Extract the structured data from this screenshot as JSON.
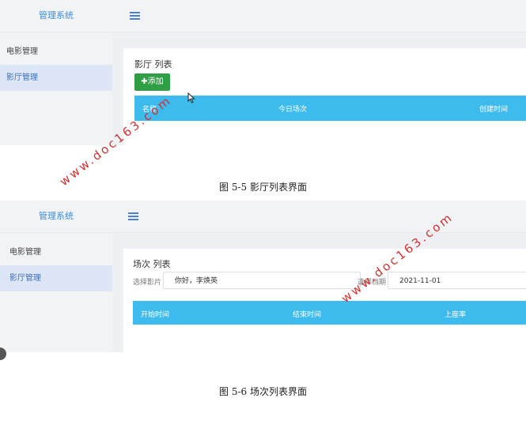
{
  "figure1": {
    "sidebar": {
      "brand": "管理系统",
      "items": [
        {
          "label": "电影管理",
          "active": false
        },
        {
          "label": "影厅管理",
          "active": true
        }
      ]
    },
    "panel_title": "影厅 列表",
    "add_button": "✚添加",
    "table_headers": [
      "名称",
      "今日场次",
      "创建时间"
    ],
    "caption": "图 5-5 影厅列表界面"
  },
  "figure2": {
    "sidebar": {
      "brand": "管理系统",
      "items": [
        {
          "label": "电影管理",
          "active": false
        },
        {
          "label": "影厅管理",
          "active": true
        }
      ]
    },
    "panel_title": "场次 列表",
    "filters": {
      "movie_label": "选择影片",
      "movie_value": "你好，李焕英",
      "date_label": "选择档期",
      "date_value": "2021-11-01"
    },
    "table_headers": [
      "开始时间",
      "结束时间",
      "上座率"
    ],
    "caption": "图 5-6 场次列表界面"
  },
  "watermark": "www.doc163.com",
  "colors": {
    "brand_text": "#3b8fd8",
    "table_header": "#3dbbed",
    "add_button": "#2f9e44",
    "active_menu": "#dce6f6",
    "watermark": "#cf3030"
  }
}
